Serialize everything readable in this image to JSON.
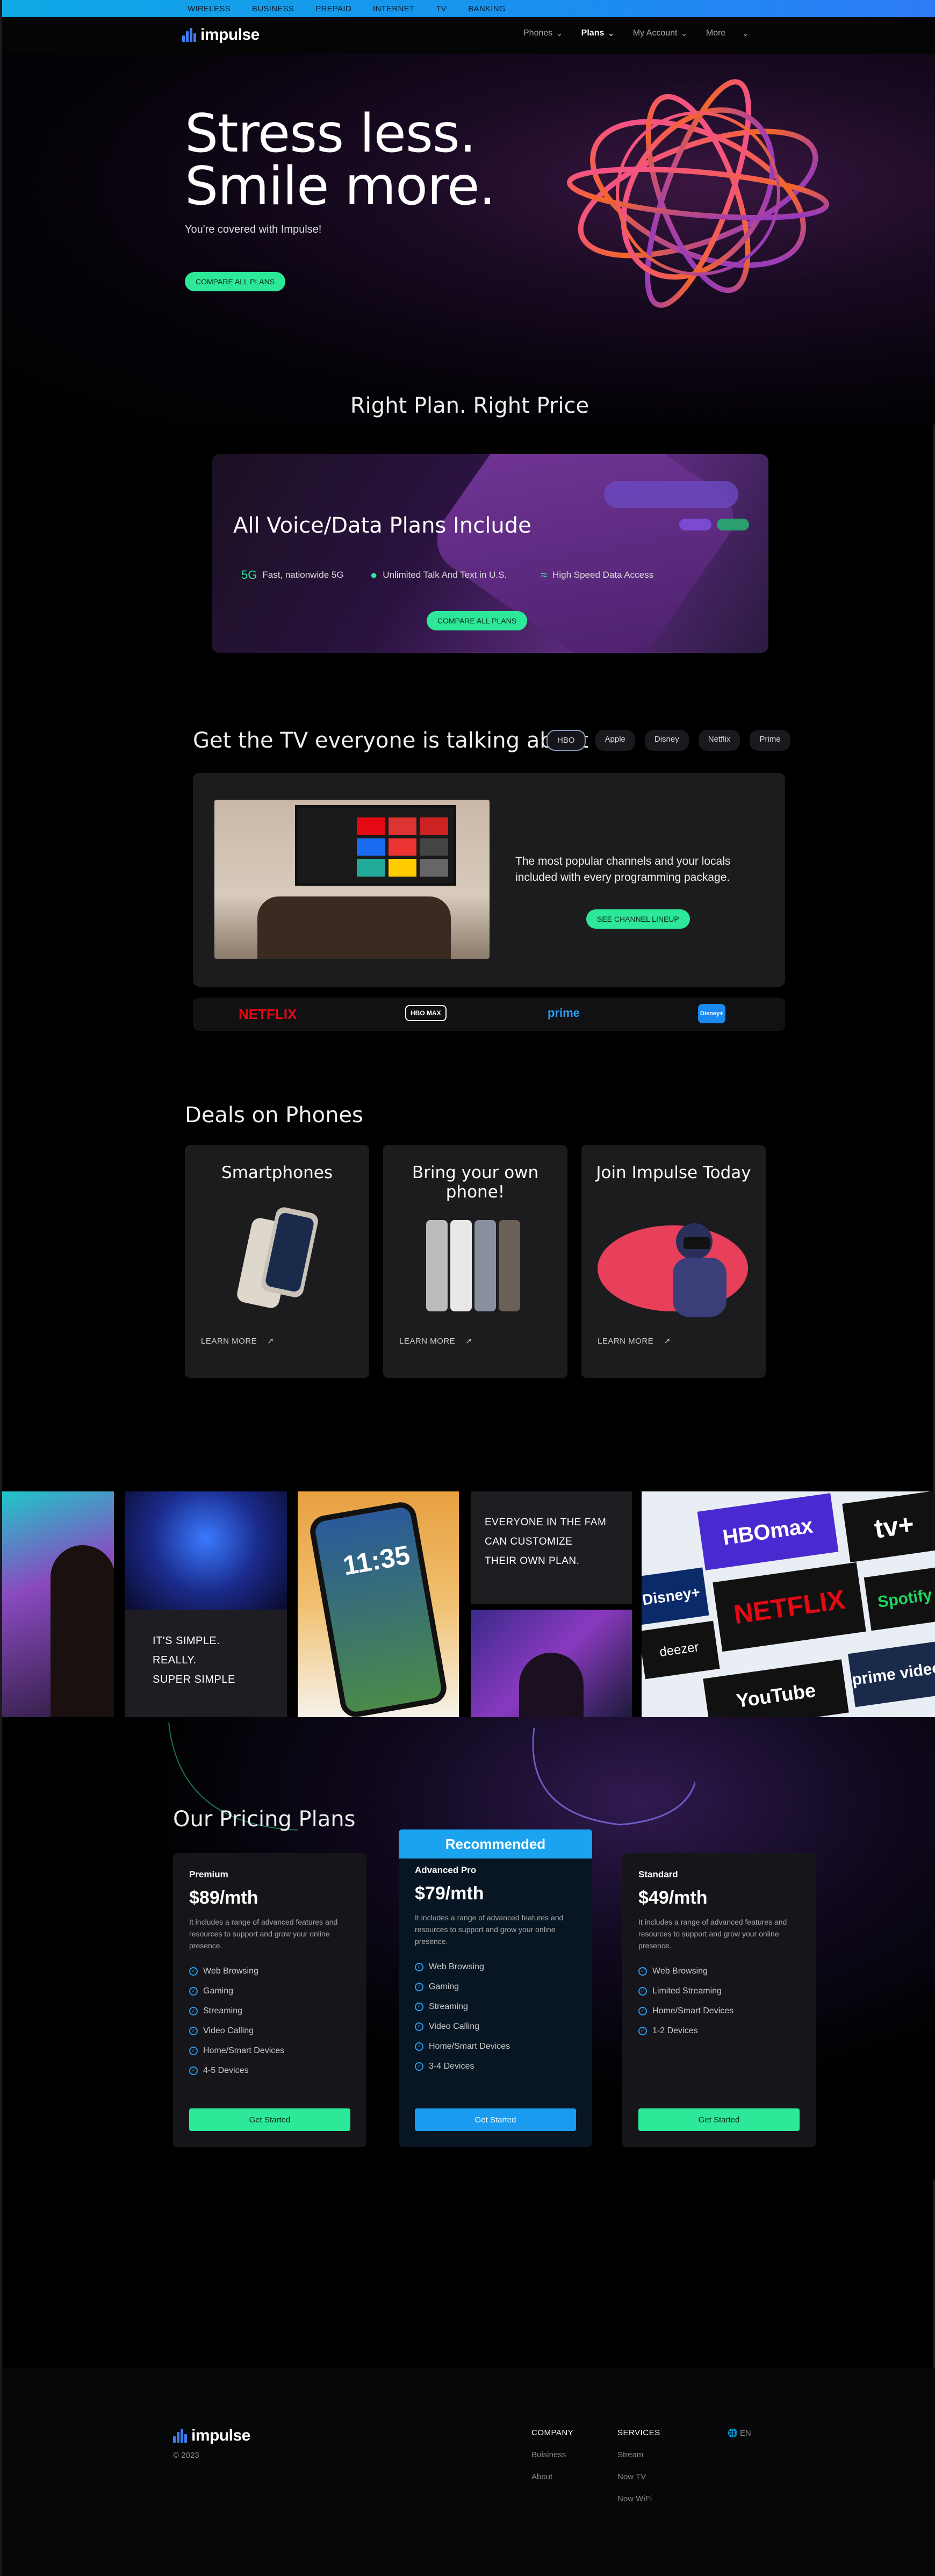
{
  "topbar": {
    "links": [
      "WIRELESS",
      "BUSINESS",
      "PREPAID",
      "INTERNET",
      "TV",
      "BANKING"
    ]
  },
  "brand": {
    "name": "impulse"
  },
  "nav": {
    "items": [
      "Phones",
      "Plans",
      "My Account",
      "More"
    ]
  },
  "hero": {
    "headline_line1": "Stress less.",
    "headline_line2": "Smile more.",
    "subtext": "You're covered with Impulse!",
    "cta": "COMPARE ALL PLANS",
    "tagline": "Right Plan. Right Price"
  },
  "include": {
    "title": "All Voice/Data Plans Include",
    "features": [
      "Fast, nationwide 5G",
      "Unlimited Talk And Text in U.S.",
      "High Speed Data Access"
    ],
    "cta": "COMPARE ALL PLANS"
  },
  "tv": {
    "title": "Get the TV everyone is talking about",
    "tabs": [
      "HBO",
      "Apple",
      "Disney",
      "Netflix",
      "Prime"
    ],
    "description": "The most popular channels and your locals included with every programming package.",
    "cta": "SEE CHANNEL LINEUP",
    "logos": [
      "NETFLIX",
      "HBO MAX",
      "prime",
      "Disney+"
    ]
  },
  "deals": {
    "title": "Deals on Phones",
    "cards": [
      {
        "title": "Smartphones",
        "link": "LEARN MORE"
      },
      {
        "title": "Bring your own phone!",
        "link": "LEARN MORE"
      },
      {
        "title": "Join Impulse Today",
        "link": "LEARN MORE"
      }
    ]
  },
  "collage": {
    "simple_text": [
      "IT'S SIMPLE.",
      "REALLY.",
      "SUPER SIMPLE"
    ],
    "fam_text": [
      "EVERYONE IN THE FAM",
      "CAN CUSTOMIZE",
      "THEIR OWN PLAN."
    ],
    "phone_time": "11:35",
    "streaming_logos": [
      "HBOmax",
      "tv+",
      "NETFLIX",
      "Disney+",
      "deezer",
      "prime video",
      "YouTube",
      "Spotify"
    ]
  },
  "pricing": {
    "title": "Our Pricing Plans",
    "recommended_label": "Recommended",
    "plans": [
      {
        "name": "Premium",
        "price": "$89/mth",
        "desc": "It includes a range of advanced features and resources to support and grow your online presence.",
        "features": [
          "Web Browsing",
          "Gaming",
          "Streaming",
          "Video Calling",
          "Home/Smart Devices",
          "4-5 Devices"
        ],
        "cta": "Get Started"
      },
      {
        "name": "Advanced Pro",
        "price": "$79/mth",
        "desc": "It includes a range of advanced features and resources to support and grow your online presence.",
        "features": [
          "Web Browsing",
          "Gaming",
          "Streaming",
          "Video Calling",
          "Home/Smart Devices",
          "3-4 Devices"
        ],
        "cta": "Get Started"
      },
      {
        "name": "Standard",
        "price": "$49/mth",
        "desc": "It includes a range of advanced features and resources to support and grow your online presence.",
        "features": [
          "Web Browsing",
          "Limited Streaming",
          "Home/Smart Devices",
          "1-2 Devices"
        ],
        "cta": "Get Started"
      }
    ]
  },
  "footer": {
    "copyright": "© 2023",
    "company": {
      "heading": "COMPANY",
      "links": [
        "Buisiness",
        "About"
      ]
    },
    "services": {
      "heading": "SERVICES",
      "links": [
        "Stream",
        "Now TV",
        "Now WiFi"
      ]
    },
    "language": "EN"
  },
  "colors": {
    "accent_green": "#2ee89a",
    "accent_blue": "#1a9bf0",
    "topbar": "#0fa9e6"
  }
}
